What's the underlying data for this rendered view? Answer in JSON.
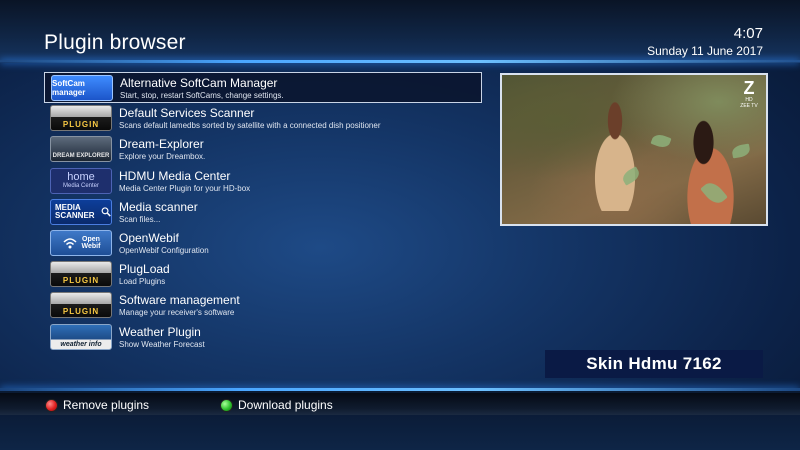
{
  "header": {
    "title": "Plugin browser",
    "time": "4:07",
    "date": "Sunday 11 June 2017"
  },
  "plugins": [
    {
      "name": "Alternative SoftCam Manager",
      "description": "Start, stop, restart SoftCams, change settings.",
      "icon": "softcam-manager-icon",
      "icon_text": "SoftCam manager",
      "selected": true
    },
    {
      "name": "Default Services Scanner",
      "description": "Scans default lamedbs sorted by satellite with a connected dish positioner",
      "icon": "plugin-icon",
      "icon_text": "PLUGIN"
    },
    {
      "name": "Dream-Explorer",
      "description": "Explore your Dreambox.",
      "icon": "dream-explorer-icon",
      "icon_text": "DREAM EXPLORER"
    },
    {
      "name": "HDMU Media Center",
      "description": "Media Center Plugin for your HD-box",
      "icon": "home-media-center-icon",
      "icon_text_top": "home",
      "icon_text_bottom": "Media Center"
    },
    {
      "name": "Media scanner",
      "description": "Scan files...",
      "icon": "media-scanner-icon",
      "icon_text_top": "MEDIA",
      "icon_text_bottom": "SCANNER"
    },
    {
      "name": "OpenWebif",
      "description": "OpenWebif Configuration",
      "icon": "openwebif-icon",
      "icon_text_top": "Open",
      "icon_text_bottom": "Webif"
    },
    {
      "name": "PlugLoad",
      "description": "Load Plugins",
      "icon": "plugin-icon",
      "icon_text": "PLUGIN"
    },
    {
      "name": "Software management",
      "description": "Manage your receiver's software",
      "icon": "plugin-icon",
      "icon_text": "PLUGIN"
    },
    {
      "name": "Weather Plugin",
      "description": "Show Weather Forecast",
      "icon": "weather-info-icon",
      "icon_text": "weather info"
    }
  ],
  "preview": {
    "channel_logo": "Z",
    "channel_logo_sub": "HD",
    "channel_logo_name": "ZEE TV"
  },
  "skin_label": "Skin Hdmu 7162",
  "footer": {
    "red_label": "Remove plugins",
    "green_label": "Download plugins"
  },
  "colors": {
    "red_button": "#e02020",
    "green_button": "#2ec02e",
    "accent_line": "#4aa6ff"
  }
}
